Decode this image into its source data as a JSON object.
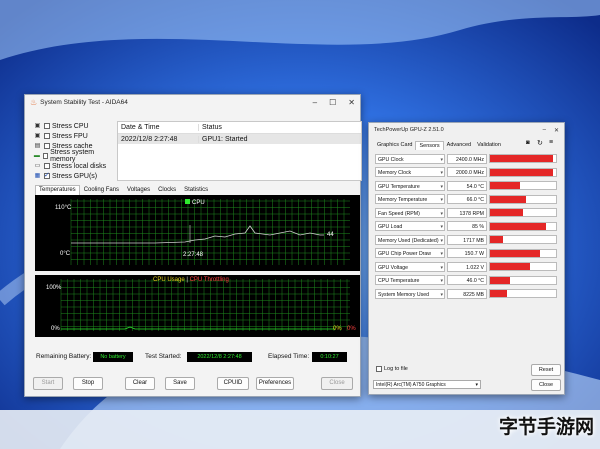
{
  "aida": {
    "title": "System Stability Test - AIDA64",
    "stress_items": [
      {
        "label": "Stress CPU",
        "checked": false,
        "icon": "cpu-icon"
      },
      {
        "label": "Stress FPU",
        "checked": false,
        "icon": "fpu-icon"
      },
      {
        "label": "Stress cache",
        "checked": false,
        "icon": "cache-icon"
      },
      {
        "label": "Stress system memory",
        "checked": false,
        "icon": "memory-icon"
      },
      {
        "label": "Stress local disks",
        "checked": false,
        "icon": "disk-icon"
      },
      {
        "label": "Stress GPU(s)",
        "checked": true,
        "icon": "gpu-icon"
      }
    ],
    "status_table": {
      "col1": "Date & Time",
      "col2": "Status",
      "rows": [
        {
          "datetime": "2022/12/8 2:27:48",
          "status": "GPU1: Started"
        }
      ]
    },
    "tabs": [
      "Temperatures",
      "Cooling Fans",
      "Voltages",
      "Clocks",
      "Statistics"
    ],
    "temp_graph": {
      "legend": "CPU",
      "y_top": "110°C",
      "y_bottom": "0°C",
      "time": "2:27:48",
      "value": "44"
    },
    "usage_graph": {
      "title_a": "CPU Usage",
      "sep": "|",
      "title_b": "CPU Throttling",
      "y_top": "100%",
      "y_bottom": "0%",
      "right_a": "0%",
      "right_b": "0%"
    },
    "battery_label": "Remaining Battery:",
    "battery_value": "No battery",
    "started_label": "Test Started:",
    "started_value": "2022/12/8 2:27:48",
    "elapsed_label": "Elapsed Time:",
    "elapsed_value": "0:10:27",
    "buttons": {
      "start": "Start",
      "stop": "Stop",
      "clear": "Clear",
      "save": "Save",
      "cpuid": "CPUID",
      "preferences": "Preferences",
      "close": "Close"
    }
  },
  "gpuz": {
    "title": "TechPowerUp GPU-Z 2.51.0",
    "tabs": [
      "Graphics Card",
      "Sensors",
      "Advanced",
      "Validation"
    ],
    "sensors": [
      {
        "name": "GPU Clock",
        "value": "2400.0 MHz",
        "level": 0.95
      },
      {
        "name": "Memory Clock",
        "value": "2000.0 MHz",
        "level": 0.95
      },
      {
        "name": "GPU Temperature",
        "value": "54.0 °C",
        "level": 0.45
      },
      {
        "name": "Memory Temperature",
        "value": "66.0 °C",
        "level": 0.55
      },
      {
        "name": "Fan Speed (RPM)",
        "value": "1378 RPM",
        "level": 0.5
      },
      {
        "name": "GPU Load",
        "value": "85 %",
        "level": 0.85
      },
      {
        "name": "Memory Used (Dedicated)",
        "value": "1717 MB",
        "level": 0.2
      },
      {
        "name": "GPU Chip Power Draw",
        "value": "150.7 W",
        "level": 0.75
      },
      {
        "name": "GPU Voltage",
        "value": "1.022 V",
        "level": 0.6
      },
      {
        "name": "CPU Temperature",
        "value": "46.0 °C",
        "level": 0.3
      },
      {
        "name": "System Memory Used",
        "value": "8225 MB",
        "level": 0.25
      }
    ],
    "log_label": "Log to file",
    "reset_label": "Reset",
    "device": "Intel(R) Arc(TM) A750 Graphics",
    "close_label": "Close"
  },
  "watermark": "字节手游网",
  "colors": {
    "accent": "#1f4fb3",
    "graph_grid": "#1f8a1f",
    "graph_line": "#2eea2e",
    "sensor_bar": "#e42727"
  }
}
